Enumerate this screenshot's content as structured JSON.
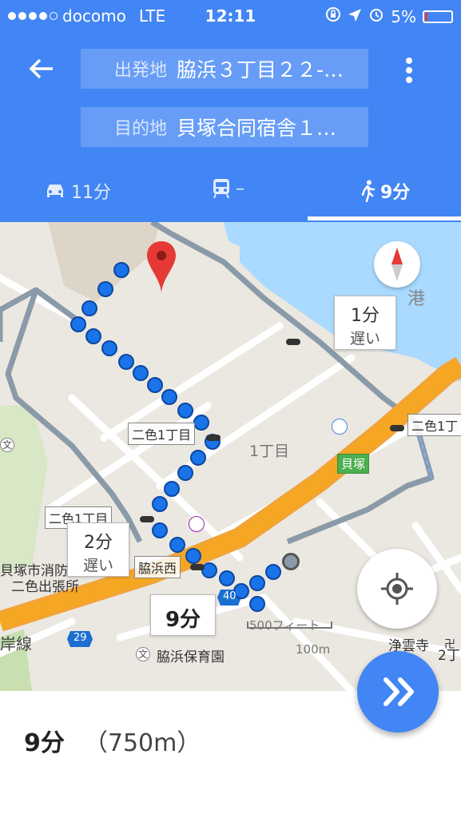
{
  "status_bar": {
    "carrier": "docomo",
    "network": "LTE",
    "time": "12:11",
    "battery": "5%"
  },
  "header": {
    "origin_label": "出発地",
    "origin_value": "脇浜３丁目２２-…",
    "destination_label": "目的地",
    "destination_value": "貝塚合同宿舎１…"
  },
  "modes": {
    "car": "11分",
    "transit": "–",
    "walk": "9分"
  },
  "map": {
    "bubble_1": {
      "time": "1分",
      "note": "遅い"
    },
    "bubble_2": {
      "time": "2分",
      "note": "遅い"
    },
    "bubble_main": "9分",
    "labels": {
      "nishiki1": "二色1丁目",
      "nishiki_right": "二色1丁",
      "nishiki_left": "二色1丁目",
      "wakihama_nishi": "脇浜西",
      "kaizuka": "貝塚",
      "chome1": "1丁目",
      "minato": "港",
      "fire_station_1": "貝塚市消防",
      "fire_station_2": "二色出張所",
      "nursery": "脇浜保育園",
      "temple": "浄雲寺",
      "chome2": "2丁",
      "shore_line": "岸線",
      "route_29": "29",
      "route_40": "40",
      "scale_ft": "500フィート",
      "scale_m": "100m",
      "school_icon": "文"
    }
  },
  "bottom": {
    "duration": "9分",
    "distance": "（750m）"
  },
  "colors": {
    "primary": "#4285f4",
    "route": "#1a73e8",
    "highway": "#f5a623"
  }
}
